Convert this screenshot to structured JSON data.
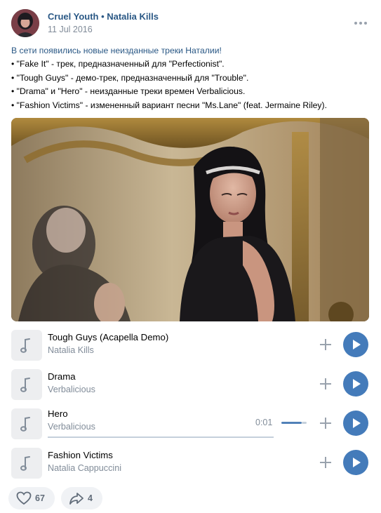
{
  "post": {
    "author": "Cruel Youth • Natalia Kills",
    "date": "11 Jul 2016",
    "text_lines": [
      "В сети появились новые неизданные треки Наталии!",
      "• \"Fake It\" - трек, предназначенный для \"Perfectionist\".",
      "• \"Tough Guys\" - демо-трек, предназначенный для \"Trouble\".",
      "• \"Drama\" и \"Hero\" - неизданные треки времен Verbalicious.",
      "• \"Fashion Victims\" - измененный вариант песни \"Ms.Lane\" (feat. Jermaine Riley)."
    ]
  },
  "icons": {
    "more": "more-horizontal-icon",
    "note": "music-note-icon",
    "add": "plus-icon",
    "play": "play-icon",
    "like": "heart-icon",
    "share": "share-arrow-icon"
  },
  "colors": {
    "link": "#2a5885",
    "secondary_text": "#818c99",
    "play_button": "#447bba",
    "pill_bg": "#f0f2f5"
  },
  "tracks": [
    {
      "title": "Tough Guys (Acapella Demo)",
      "artist": "Natalia Kills"
    },
    {
      "title": "Drama",
      "artist": "Verbalicious"
    },
    {
      "title": "Hero",
      "artist": "Verbalicious",
      "time": "0:01",
      "volume_level": 0.8,
      "playback_progress": 0.0
    },
    {
      "title": "Fashion Victims",
      "artist": "Natalia Cappuccini"
    }
  ],
  "footer": {
    "likes": "67",
    "shares": "4"
  }
}
